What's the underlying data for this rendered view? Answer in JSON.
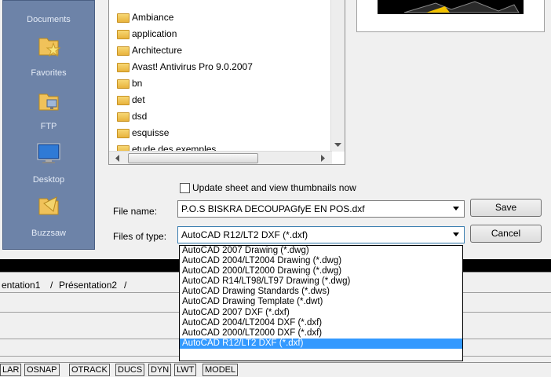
{
  "places": [
    {
      "label": "Documents",
      "icon": "documents-icon"
    },
    {
      "label": "Favorites",
      "icon": "favorites-icon"
    },
    {
      "label": "FTP",
      "icon": "ftp-icon"
    },
    {
      "label": "Desktop",
      "icon": "desktop-icon"
    },
    {
      "label": "Buzzsaw",
      "icon": "buzzsaw-icon"
    }
  ],
  "files": [
    "Ambiance",
    "application",
    "Architecture",
    "Avast! Antivirus Pro 9.0.2007",
    "bn",
    "det",
    "dsd",
    "esquisse",
    "etude des exemples"
  ],
  "thumbnails_checkbox_label": "Update sheet and view thumbnails now",
  "file_name": {
    "label": "File name:",
    "value": "P.O.S BISKRA DECOUPAGfyE EN POS.dxf"
  },
  "file_type": {
    "label": "Files of type:",
    "value": "AutoCAD R12/LT2 DXF (*.dxf)"
  },
  "buttons": {
    "save": "Save",
    "cancel": "Cancel"
  },
  "file_type_options": [
    "AutoCAD 2007 Drawing (*.dwg)",
    "AutoCAD 2004/LT2004 Drawing (*.dwg)",
    "AutoCAD 2000/LT2000 Drawing (*.dwg)",
    "AutoCAD R14/LT98/LT97 Drawing (*.dwg)",
    "AutoCAD Drawing Standards (*.dws)",
    "AutoCAD Drawing Template (*.dwt)",
    "AutoCAD 2007 DXF (*.dxf)",
    "AutoCAD 2004/LT2004 DXF (*.dxf)",
    "AutoCAD 2000/LT2000 DXF (*.dxf)",
    "AutoCAD R12/LT2 DXF (*.dxf)"
  ],
  "selected_option_index": 9,
  "layout_tabs": [
    "entation1",
    "Présentation2"
  ],
  "status_buttons": [
    "LAR",
    "OSNAP",
    "OTRACK",
    "DUCS",
    "DYN",
    "LWT",
    "MODEL"
  ],
  "colors": {
    "places_bg": "#6d83a8",
    "selection": "#3399ff"
  }
}
